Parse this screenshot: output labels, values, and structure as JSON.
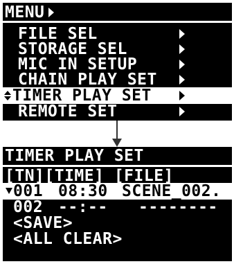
{
  "top_screen": {
    "title": "MENU",
    "items": [
      {
        "label": "FILE SEL"
      },
      {
        "label": "STORAGE SEL"
      },
      {
        "label": "MIC IN SETUP"
      },
      {
        "label": "CHAIN PLAY SET"
      },
      {
        "label": "TIMER PLAY SET",
        "selected": true
      },
      {
        "label": "REMOTE SET"
      }
    ]
  },
  "bottom_screen": {
    "title": "TIMER PLAY SET",
    "header": "[TN][TIME] [FILE]",
    "rows": [
      {
        "tn": "001",
        "time": "08:30",
        "file": "SCENE_002.",
        "selected": true
      },
      {
        "tn": "002",
        "time": "--:--",
        "file": "--------"
      }
    ],
    "actions": [
      "<SAVE>",
      "<ALL CLEAR>"
    ]
  }
}
